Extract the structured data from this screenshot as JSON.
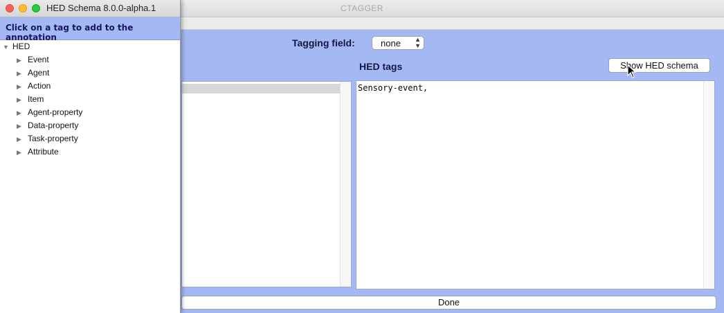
{
  "main_window": {
    "title": "CTAGGER",
    "tagging_field_label": "Tagging field:",
    "tagging_field_value": "none",
    "hed_tags_label": "HED tags",
    "show_schema_button": "Show HED schema",
    "hed_tags_text": "Sensory-event,",
    "done_button": "Done"
  },
  "schema_window": {
    "title": "HED Schema 8.0.0-alpha.1",
    "instruction": "Click on a tag to add to the annotation",
    "root_label": "HED",
    "items": [
      {
        "label": "Event"
      },
      {
        "label": "Agent"
      },
      {
        "label": "Action"
      },
      {
        "label": "Item"
      },
      {
        "label": "Agent-property"
      },
      {
        "label": "Data-property"
      },
      {
        "label": "Task-property"
      },
      {
        "label": "Attribute"
      }
    ]
  },
  "colors": {
    "panel_blue": "#a4b8f4",
    "label_navy": "#161646"
  },
  "icons": {
    "expanded": "triangle-down-icon",
    "collapsed": "triangle-right-icon",
    "cursor": "arrow-cursor-icon"
  }
}
